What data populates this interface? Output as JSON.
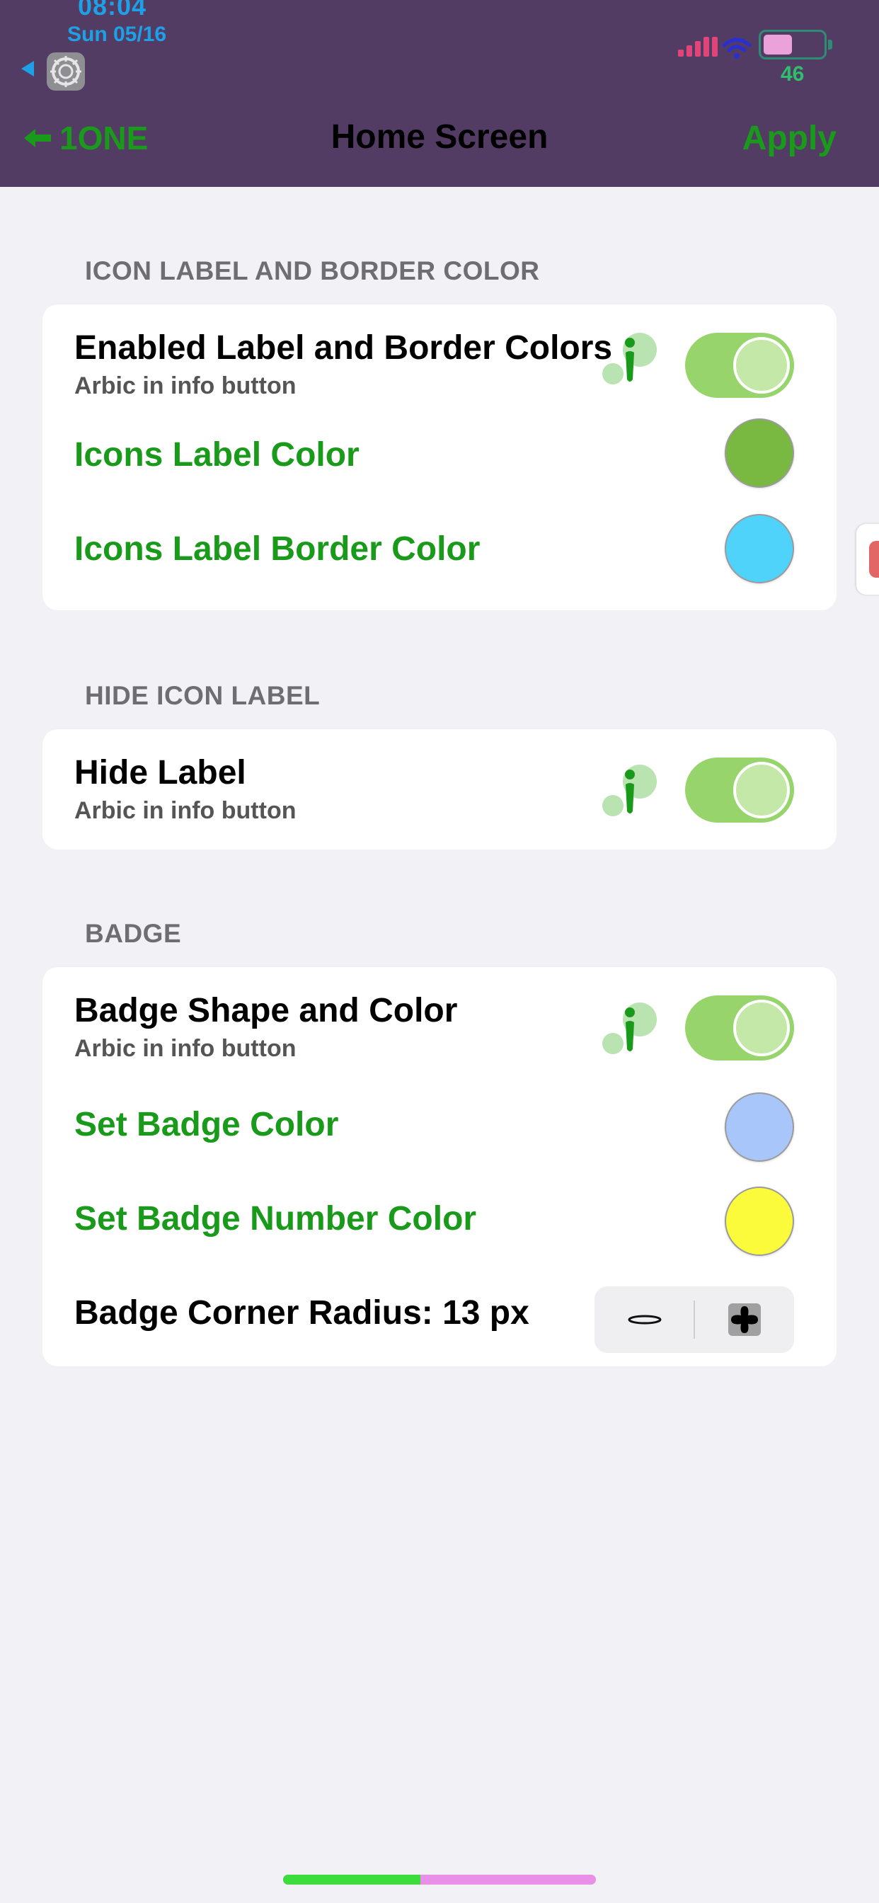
{
  "status_bar": {
    "time": "08:04",
    "date": "Sun 05/16",
    "battery_percent": "46",
    "battery_level": 0.46,
    "icons": [
      "back-triangle-icon",
      "settings-gear-icon",
      "cellular-signal-icon",
      "wifi-icon",
      "battery-icon"
    ]
  },
  "nav": {
    "back_label": "1ONE",
    "title": "Home Screen",
    "apply_label": "Apply"
  },
  "sections": {
    "label_color": {
      "header": "ICON LABEL AND BORDER COLOR",
      "toggle_title": "Enabled Label and Border Colors",
      "toggle_subtitle": "Arbic in info button",
      "toggle_on": true,
      "label_color_title": "Icons Label Color",
      "label_color_value": "#79b941",
      "border_color_title": "Icons Label Border Color",
      "border_color_value": "#4fd3fb"
    },
    "hide_label": {
      "header": "HIDE ICON LABEL",
      "toggle_title": "Hide Label",
      "toggle_subtitle": "Arbic in info button",
      "toggle_on": true
    },
    "badge": {
      "header": "BADGE",
      "toggle_title": "Badge Shape and Color",
      "toggle_subtitle": "Arbic in info button",
      "toggle_on": true,
      "badge_color_title": "Set Badge Color",
      "badge_color_value": "#a9c6fb",
      "number_color_title": "Set Badge Number Color",
      "number_color_value": "#fbfb3c",
      "radius_title": "Badge Corner Radius: 13 px"
    }
  },
  "colors": {
    "header_bg": "#533c64",
    "accent_green": "#1a9a1a",
    "toggle_on": "#98d46c",
    "page_bg": "#f2f1f6"
  },
  "home_indicator_progress": 0.44
}
